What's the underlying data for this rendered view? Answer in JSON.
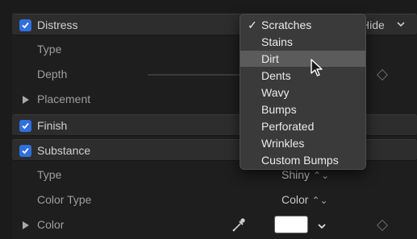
{
  "rows": {
    "distress": {
      "label": "Distress",
      "checked": true,
      "hide_label": "Hide"
    },
    "type1": {
      "label": "Type"
    },
    "depth": {
      "label": "Depth"
    },
    "placement": {
      "label": "Placement"
    },
    "finish": {
      "label": "Finish",
      "checked": true
    },
    "substance": {
      "label": "Substance",
      "checked": true
    },
    "type2": {
      "label": "Type",
      "value": "Shiny"
    },
    "color_type": {
      "label": "Color Type",
      "value": "Color"
    },
    "color": {
      "label": "Color",
      "swatch": "#ffffff"
    }
  },
  "menu": {
    "items": [
      {
        "label": "Scratches",
        "checked": true
      },
      {
        "label": "Stains"
      },
      {
        "label": "Dirt",
        "highlighted": true
      },
      {
        "label": "Dents"
      },
      {
        "label": "Wavy"
      },
      {
        "label": "Bumps"
      },
      {
        "label": "Perforated"
      },
      {
        "label": "Wrinkles"
      },
      {
        "label": "Custom Bumps"
      }
    ]
  },
  "icons": {
    "checkbox": "checkmark-icon",
    "disclosure": "disclosure-triangle-icon",
    "keyframe": "diamond-icon",
    "eyedropper": "eyedropper-icon",
    "cursor": "pointer-cursor-icon"
  },
  "colors": {
    "accent": "#2f6fe0",
    "menu_highlight": "#5b5b5b",
    "group_bg": "#2d2d2d"
  }
}
